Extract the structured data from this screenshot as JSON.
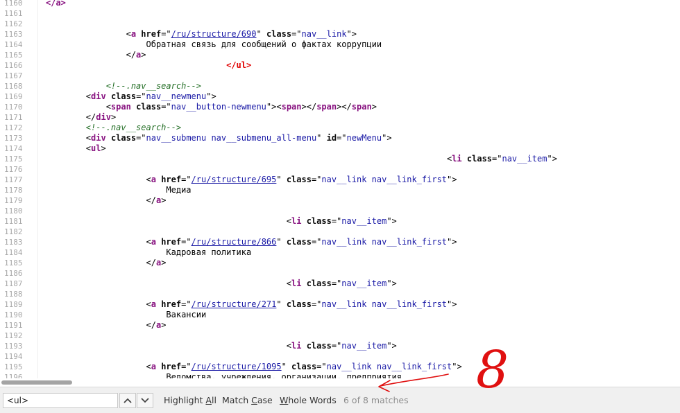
{
  "code_lines": [
    {
      "n": "1160",
      "seg": [
        {
          "c": "tg",
          "t": "</a>"
        }
      ]
    },
    {
      "n": "1161",
      "seg": []
    },
    {
      "n": "1162",
      "seg": []
    },
    {
      "n": "1163",
      "seg": [
        {
          "t": "                <"
        },
        {
          "c": "tg",
          "t": "a"
        },
        {
          "t": " "
        },
        {
          "c": "an",
          "t": "href"
        },
        {
          "t": "=\""
        },
        {
          "c": "lk",
          "t": "/ru/structure/690"
        },
        {
          "t": "\" "
        },
        {
          "c": "an",
          "t": "class"
        },
        {
          "t": "=\""
        },
        {
          "c": "av",
          "t": "nav__link"
        },
        {
          "t": "\">"
        }
      ]
    },
    {
      "n": "1164",
      "seg": [
        {
          "t": "                    Обратная связь для сообщений о фактах коррупции"
        }
      ]
    },
    {
      "n": "1165",
      "seg": [
        {
          "t": "                </"
        },
        {
          "c": "tg",
          "t": "a"
        },
        {
          "t": ">"
        }
      ]
    },
    {
      "n": "1166",
      "seg": [
        {
          "t": "                                    "
        },
        {
          "c": "er",
          "t": "</ul>"
        }
      ]
    },
    {
      "n": "1167",
      "seg": []
    },
    {
      "n": "1168",
      "seg": [
        {
          "t": "            "
        },
        {
          "c": "cm",
          "t": "<!--.nav__search-->"
        }
      ]
    },
    {
      "n": "1169",
      "seg": [
        {
          "t": "        <"
        },
        {
          "c": "tg",
          "t": "div"
        },
        {
          "t": " "
        },
        {
          "c": "an",
          "t": "class"
        },
        {
          "t": "=\""
        },
        {
          "c": "av",
          "t": "nav__newmenu"
        },
        {
          "t": "\">"
        }
      ]
    },
    {
      "n": "1170",
      "seg": [
        {
          "t": "            <"
        },
        {
          "c": "tg",
          "t": "span"
        },
        {
          "t": " "
        },
        {
          "c": "an",
          "t": "class"
        },
        {
          "t": "=\""
        },
        {
          "c": "av",
          "t": "nav__button-newmenu"
        },
        {
          "t": "\"><"
        },
        {
          "c": "tg",
          "t": "span"
        },
        {
          "t": "></"
        },
        {
          "c": "tg",
          "t": "span"
        },
        {
          "t": "></"
        },
        {
          "c": "tg",
          "t": "span"
        },
        {
          "t": ">"
        }
      ]
    },
    {
      "n": "1171",
      "seg": [
        {
          "t": "        </"
        },
        {
          "c": "tg",
          "t": "div"
        },
        {
          "t": ">"
        }
      ]
    },
    {
      "n": "1172",
      "seg": [
        {
          "t": "        "
        },
        {
          "c": "cm",
          "t": "<!--.nav__search-->"
        }
      ]
    },
    {
      "n": "1173",
      "seg": [
        {
          "t": "        <"
        },
        {
          "c": "tg",
          "t": "div"
        },
        {
          "t": " "
        },
        {
          "c": "an",
          "t": "class"
        },
        {
          "t": "=\""
        },
        {
          "c": "av",
          "t": "nav__submenu nav__submenu_all-menu"
        },
        {
          "t": "\" "
        },
        {
          "c": "an",
          "t": "id"
        },
        {
          "t": "=\""
        },
        {
          "c": "av",
          "t": "newMenu"
        },
        {
          "t": "\">"
        }
      ]
    },
    {
      "n": "1174",
      "seg": [
        {
          "t": "        <"
        },
        {
          "c": "tg",
          "t": "ul"
        },
        {
          "t": ">"
        }
      ]
    },
    {
      "n": "1175",
      "seg": [
        {
          "t": "                                                                                <"
        },
        {
          "c": "tg",
          "t": "li"
        },
        {
          "t": " "
        },
        {
          "c": "an",
          "t": "class"
        },
        {
          "t": "=\""
        },
        {
          "c": "av",
          "t": "nav__item"
        },
        {
          "t": "\">"
        }
      ]
    },
    {
      "n": "1176",
      "seg": []
    },
    {
      "n": "1177",
      "seg": [
        {
          "t": "                    <"
        },
        {
          "c": "tg",
          "t": "a"
        },
        {
          "t": " "
        },
        {
          "c": "an",
          "t": "href"
        },
        {
          "t": "=\""
        },
        {
          "c": "lk",
          "t": "/ru/structure/695"
        },
        {
          "t": "\" "
        },
        {
          "c": "an",
          "t": "class"
        },
        {
          "t": "=\""
        },
        {
          "c": "av",
          "t": "nav__link nav__link_first"
        },
        {
          "t": "\">"
        }
      ]
    },
    {
      "n": "1178",
      "seg": [
        {
          "t": "                        Медиа"
        }
      ]
    },
    {
      "n": "1179",
      "seg": [
        {
          "t": "                    </"
        },
        {
          "c": "tg",
          "t": "a"
        },
        {
          "t": ">"
        }
      ]
    },
    {
      "n": "1180",
      "seg": []
    },
    {
      "n": "1181",
      "seg": [
        {
          "t": "                                                <"
        },
        {
          "c": "tg",
          "t": "li"
        },
        {
          "t": " "
        },
        {
          "c": "an",
          "t": "class"
        },
        {
          "t": "=\""
        },
        {
          "c": "av",
          "t": "nav__item"
        },
        {
          "t": "\">"
        }
      ]
    },
    {
      "n": "1182",
      "seg": []
    },
    {
      "n": "1183",
      "seg": [
        {
          "t": "                    <"
        },
        {
          "c": "tg",
          "t": "a"
        },
        {
          "t": " "
        },
        {
          "c": "an",
          "t": "href"
        },
        {
          "t": "=\""
        },
        {
          "c": "lk",
          "t": "/ru/structure/866"
        },
        {
          "t": "\" "
        },
        {
          "c": "an",
          "t": "class"
        },
        {
          "t": "=\""
        },
        {
          "c": "av",
          "t": "nav__link nav__link_first"
        },
        {
          "t": "\">"
        }
      ]
    },
    {
      "n": "1184",
      "seg": [
        {
          "t": "                        Кадровая политика"
        }
      ]
    },
    {
      "n": "1185",
      "seg": [
        {
          "t": "                    </"
        },
        {
          "c": "tg",
          "t": "a"
        },
        {
          "t": ">"
        }
      ]
    },
    {
      "n": "1186",
      "seg": []
    },
    {
      "n": "1187",
      "seg": [
        {
          "t": "                                                <"
        },
        {
          "c": "tg",
          "t": "li"
        },
        {
          "t": " "
        },
        {
          "c": "an",
          "t": "class"
        },
        {
          "t": "=\""
        },
        {
          "c": "av",
          "t": "nav__item"
        },
        {
          "t": "\">"
        }
      ]
    },
    {
      "n": "1188",
      "seg": []
    },
    {
      "n": "1189",
      "seg": [
        {
          "t": "                    <"
        },
        {
          "c": "tg",
          "t": "a"
        },
        {
          "t": " "
        },
        {
          "c": "an",
          "t": "href"
        },
        {
          "t": "=\""
        },
        {
          "c": "lk",
          "t": "/ru/structure/271"
        },
        {
          "t": "\" "
        },
        {
          "c": "an",
          "t": "class"
        },
        {
          "t": "=\""
        },
        {
          "c": "av",
          "t": "nav__link nav__link_first"
        },
        {
          "t": "\">"
        }
      ]
    },
    {
      "n": "1190",
      "seg": [
        {
          "t": "                        Вакансии"
        }
      ]
    },
    {
      "n": "1191",
      "seg": [
        {
          "t": "                    </"
        },
        {
          "c": "tg",
          "t": "a"
        },
        {
          "t": ">"
        }
      ]
    },
    {
      "n": "1192",
      "seg": []
    },
    {
      "n": "1193",
      "seg": [
        {
          "t": "                                                <"
        },
        {
          "c": "tg",
          "t": "li"
        },
        {
          "t": " "
        },
        {
          "c": "an",
          "t": "class"
        },
        {
          "t": "=\""
        },
        {
          "c": "av",
          "t": "nav__item"
        },
        {
          "t": "\">"
        }
      ]
    },
    {
      "n": "1194",
      "seg": []
    },
    {
      "n": "1195",
      "seg": [
        {
          "t": "                    <"
        },
        {
          "c": "tg",
          "t": "a"
        },
        {
          "t": " "
        },
        {
          "c": "an",
          "t": "href"
        },
        {
          "t": "=\""
        },
        {
          "c": "lk",
          "t": "/ru/structure/1095"
        },
        {
          "t": "\" "
        },
        {
          "c": "an",
          "t": "class"
        },
        {
          "t": "=\""
        },
        {
          "c": "av",
          "t": "nav__link nav__link_first"
        },
        {
          "t": "\">"
        }
      ]
    },
    {
      "n": "1196",
      "seg": [
        {
          "t": "                        Ведомства, учреждения, организации, предприятия"
        }
      ]
    }
  ],
  "find_bar": {
    "search_value": "<ul>",
    "prev_icon": "chevron-up-icon",
    "next_icon": "chevron-down-icon",
    "highlight_all": {
      "before": "Highlight ",
      "key": "A",
      "after": "ll"
    },
    "match_case": {
      "before": "Match ",
      "key": "C",
      "after": "ase"
    },
    "whole_words": {
      "before": "",
      "key": "W",
      "after": "hole Words"
    },
    "status": "6 of 8 matches"
  },
  "annotation": {
    "color": "#e01010",
    "text": "8",
    "shape": "handwritten arrow pointing left"
  }
}
